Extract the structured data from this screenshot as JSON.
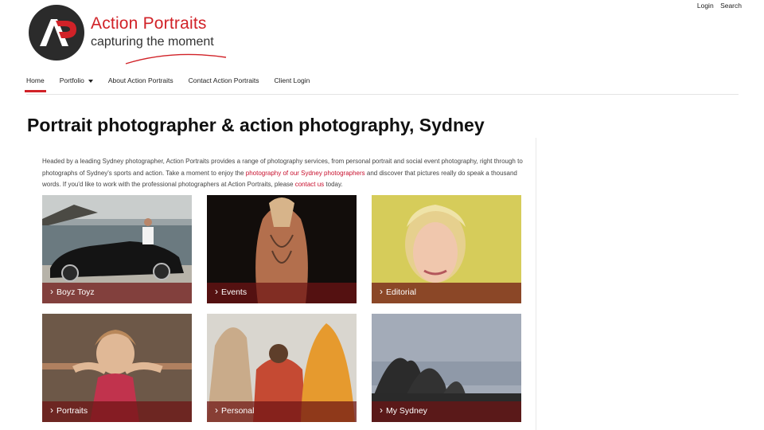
{
  "utility": {
    "login": "Login",
    "search": "Search"
  },
  "logo": {
    "monogram": "AP",
    "title": "Action Portraits",
    "tagline": "capturing the moment"
  },
  "nav": [
    {
      "label": "Home",
      "active": true
    },
    {
      "label": "Portfolio",
      "dropdown": true
    },
    {
      "label": "About Action Portraits"
    },
    {
      "label": "Contact Action Portraits"
    },
    {
      "label": "Client Login"
    }
  ],
  "page": {
    "title": "Portrait photographer & action photography, Sydney",
    "intro_1": "Headed by a leading Sydney photographer, Action Portraits provides a range of photography services, from personal portrait and social event photography, right through to photographs of Sydney's sports and action. Take a moment to enjoy the ",
    "intro_link_1": "photography of our Sydney photographers",
    "intro_2": " and discover that pictures really do speak a thousand words. If you'd like to work with the professional photographers at Action Portraits, please ",
    "intro_link_2": "contact us",
    "intro_3": " today."
  },
  "tiles": [
    {
      "label": "Boyz Toyz"
    },
    {
      "label": "Events"
    },
    {
      "label": "Editorial"
    },
    {
      "label": "Portraits"
    },
    {
      "label": "Personal"
    },
    {
      "label": "My Sydney"
    }
  ],
  "colors": {
    "accent": "#d12228",
    "link": "#c8102e",
    "band": "#6e1414"
  }
}
